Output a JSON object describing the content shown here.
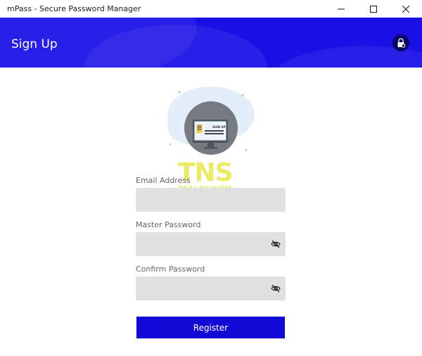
{
  "window": {
    "title": "mPass - Secure Password Manager"
  },
  "header": {
    "title": "Sign Up",
    "background": "#1a10e6"
  },
  "illustration": {
    "screen_label": "SIGN UP"
  },
  "watermark": {
    "letters": "TNS",
    "subtitle": "TRẢI NGHIỆM SỐ"
  },
  "form": {
    "email": {
      "label": "Email Address",
      "value": ""
    },
    "master_password": {
      "label": "Master Password",
      "value": ""
    },
    "confirm_password": {
      "label": "Confirm Password",
      "value": ""
    },
    "register_label": "Register",
    "accent": "#1209d6"
  },
  "icons": {
    "minimize": "minimize-icon",
    "maximize": "maximize-icon",
    "close": "close-icon",
    "lock": "lock-icon",
    "eye": "eye-slash-icon"
  }
}
